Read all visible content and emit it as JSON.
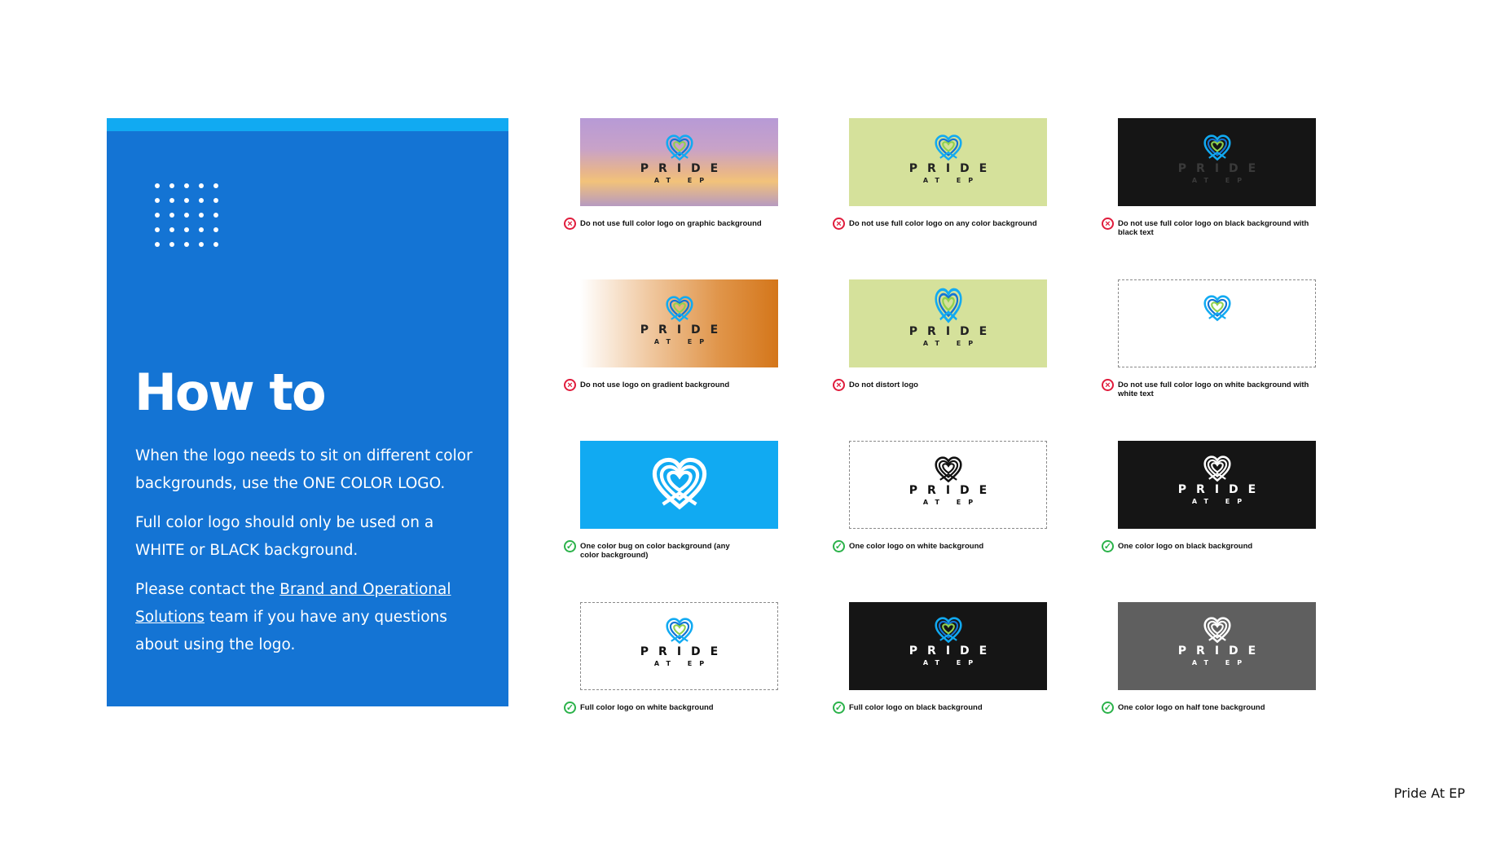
{
  "panel": {
    "title": "How to",
    "para1": "When the logo needs to sit on different color backgrounds, use the ONE COLOR LOGO.",
    "para2": "Full color logo should only be used on a WHITE or BLACK background.",
    "para3_pre": "Please contact the ",
    "para3_link": "Brand and Operational Solutions",
    "para3_post": " team if you have any questions about using the logo."
  },
  "logo": {
    "word": "PRIDE",
    "sub": "AT EP"
  },
  "icons": {
    "dont": "cross-circle-icon",
    "do": "check-circle-icon"
  },
  "colors": {
    "panel": "#1474d4",
    "panel_bar": "#11aaf2",
    "lime": "#d5e19b",
    "black": "#151515",
    "cyan": "#11aaf2",
    "gray": "#5f5f5f",
    "bad": "#e01c3c",
    "good": "#2bb24a"
  },
  "examples": [
    {
      "caption": "Do not use full color logo on graphic background",
      "status": "dont"
    },
    {
      "caption": "Do not use full color logo on any color background",
      "status": "dont"
    },
    {
      "caption": "Do not use full color logo on black background with black text",
      "status": "dont"
    },
    {
      "caption": "Do not use logo on gradient background",
      "status": "dont"
    },
    {
      "caption": "Do not distort logo",
      "status": "dont"
    },
    {
      "caption": "Do not use full color logo on white background with white text",
      "status": "dont"
    },
    {
      "caption": "One color bug on color background (any color background)",
      "status": "do"
    },
    {
      "caption": "One color logo on white background",
      "status": "do"
    },
    {
      "caption": "One color logo on black background",
      "status": "do"
    },
    {
      "caption": "Full color logo on white background",
      "status": "do"
    },
    {
      "caption": "Full color logo on black background",
      "status": "do"
    },
    {
      "caption": "One color logo on half tone background",
      "status": "do"
    }
  ],
  "footer": "Pride At EP"
}
